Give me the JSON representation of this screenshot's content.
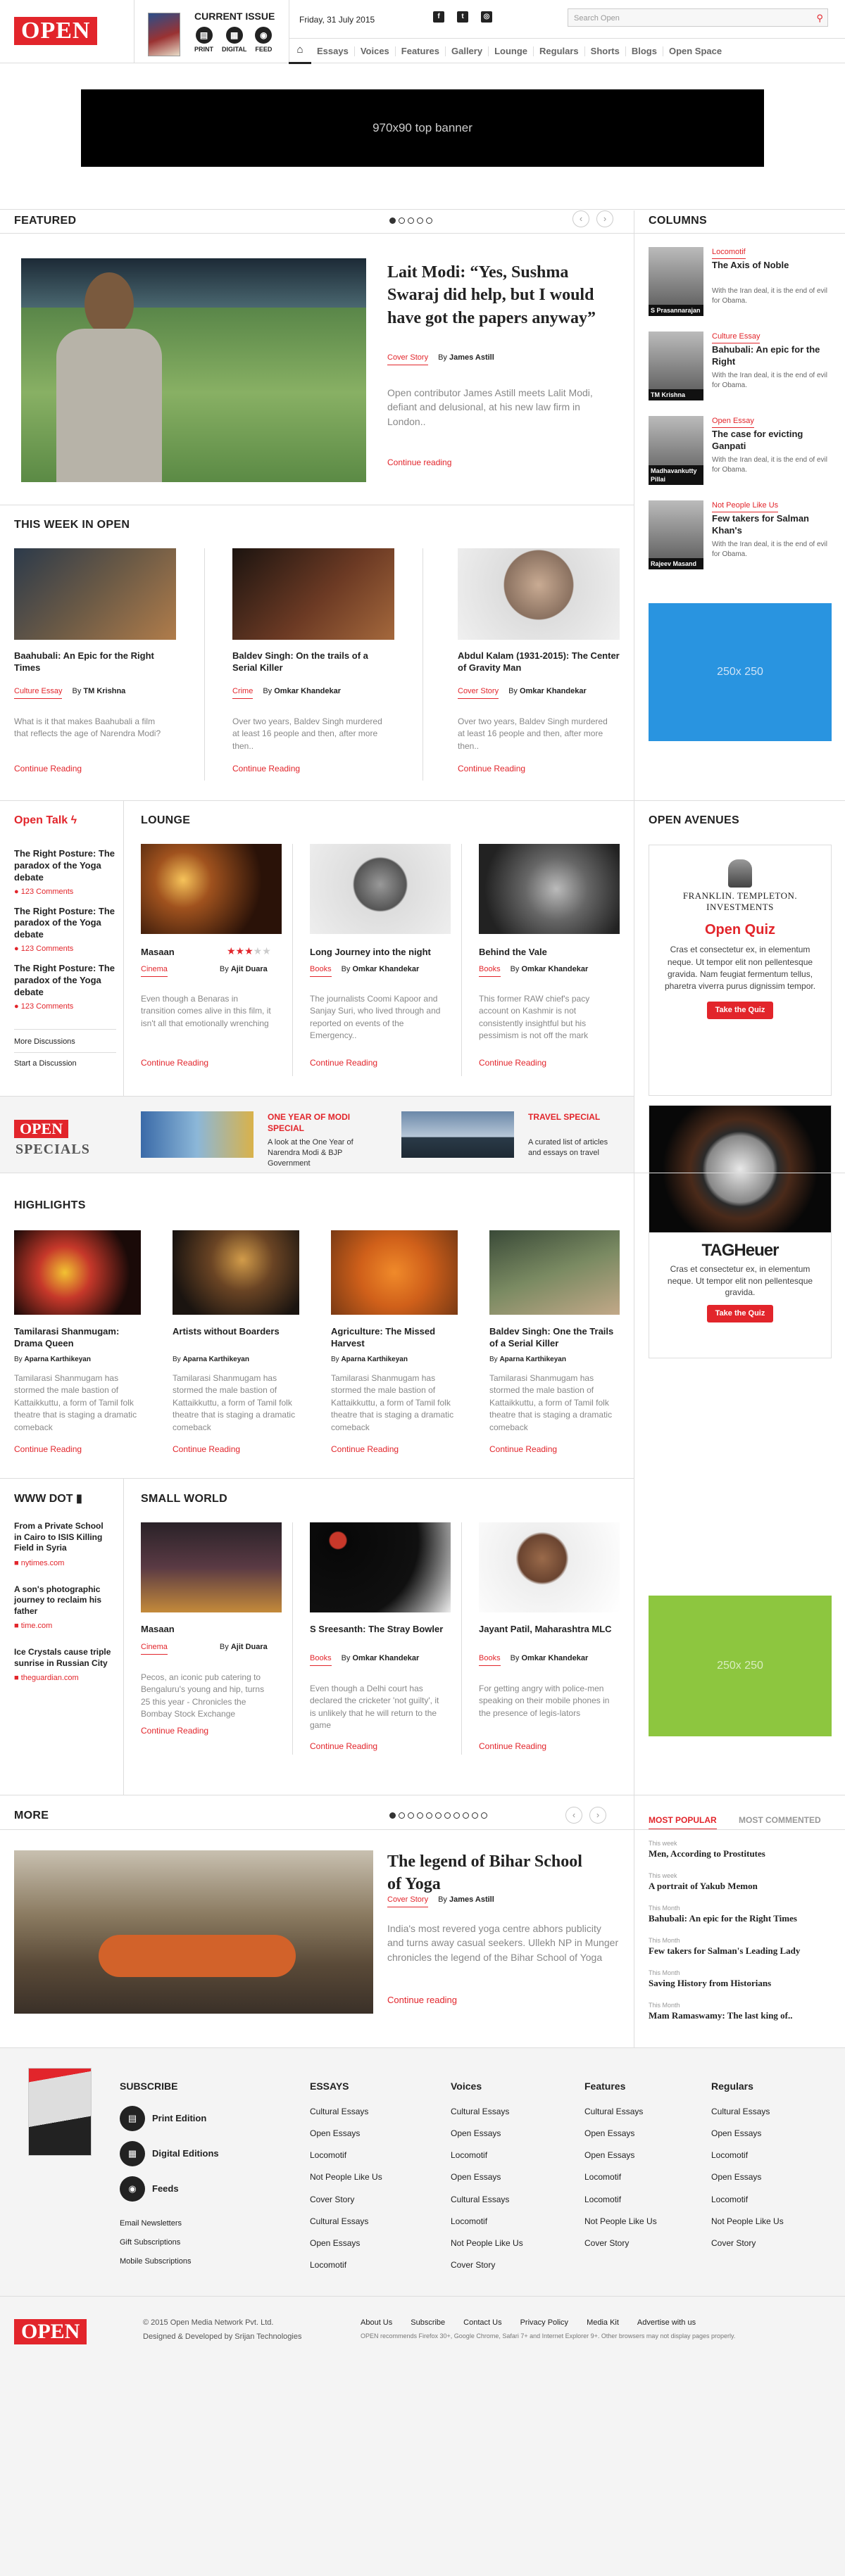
{
  "header": {
    "logo": "OPEN",
    "issue_title": "CURRENT ISSUE",
    "issue_links": [
      {
        "label": "PRINT",
        "glyph": "▤"
      },
      {
        "label": "DIGITAL",
        "glyph": "▦"
      },
      {
        "label": "FEED",
        "glyph": "◉"
      }
    ],
    "date": "Friday, 31 July 2015",
    "social": [
      "f",
      "t",
      "◎"
    ],
    "search_placeholder": "Search Open",
    "nav": [
      "Essays",
      "Voices",
      "Features",
      "Gallery",
      "Lounge",
      "Regulars",
      "Shorts",
      "Blogs",
      "Open Space"
    ]
  },
  "banner": {
    "label": "970x90 top banner"
  },
  "featured": {
    "title": "FEATURED",
    "headline": "Lait Modi: “Yes, Sushma Swaraj did help, but I would have got the papers anyway”",
    "category": "Cover Story",
    "by": "By",
    "author": "James Astill",
    "excerpt": "Open contributor James Astill meets Lalit Modi, defiant and delusional, at his new law firm in London..",
    "continue": "Continue reading"
  },
  "week": {
    "title": "THIS WEEK IN OPEN",
    "items": [
      {
        "headline": "Baahubali: An Epic for the Right Times",
        "category": "Culture Essay",
        "author": "TM Krishna",
        "excerpt": "What is it that makes Baahubali a film that reflects the age of Narendra Modi?",
        "continue": "Continue Reading"
      },
      {
        "headline": "Baldev Singh: On the trails of a Serial Killer",
        "category": "Crime",
        "author": "Omkar Khandekar",
        "excerpt": "Over two years, Baldev Singh murdered at least 16 people and then, after more then..",
        "continue": "Continue Reading"
      },
      {
        "headline": "Abdul Kalam (1931-2015): The Center of Gravity Man",
        "category": "Cover Story",
        "author": "Omkar Khandekar",
        "excerpt": "Over two years, Baldev Singh murdered at least 16 people and then, after more then..",
        "continue": "Continue Reading"
      }
    ]
  },
  "opentalk": {
    "title": "Open Talk",
    "items": [
      {
        "headline": "The Right Posture: The paradox of the Yoga debate",
        "comments": "123 Comments"
      },
      {
        "headline": "The Right Posture: The paradox of the Yoga debate",
        "comments": "123 Comments"
      },
      {
        "headline": "The Right Posture: The paradox of the Yoga debate",
        "comments": "123 Comments"
      }
    ],
    "more": "More Discussions",
    "start": "Start a Discussion"
  },
  "lounge": {
    "title": "LOUNGE",
    "items": [
      {
        "headline": "Masaan",
        "category": "Cinema",
        "author": "Ajit Duara",
        "rating": 3,
        "excerpt": "Even though a Benaras in transition comes alive in this film, it isn't all that emotionally wrenching",
        "continue": "Continue Reading"
      },
      {
        "headline": "Long Journey into the night",
        "category": "Books",
        "author": "Omkar Khandekar",
        "excerpt": "The journalists Coomi Kapoor and Sanjay Suri, who lived through and reported on events of the Emergency..",
        "continue": "Continue Reading"
      },
      {
        "headline": "Behind the Vale",
        "category": "Books",
        "author": "Omkar Khandekar",
        "excerpt": "This former RAW chief's pacy account on Kashmir is not consistently insightful but his pessimism is not off the mark",
        "continue": "Continue Reading"
      }
    ]
  },
  "specials": {
    "logo_top": "OPEN",
    "logo_bottom": "SPECIALS",
    "items": [
      {
        "title": "ONE YEAR OF MODI SPECIAL",
        "text": "A look at the One Year of Narendra Modi & BJP Government"
      },
      {
        "title": "TRAVEL SPECIAL",
        "text": "A curated list of articles and essays on travel"
      }
    ]
  },
  "highlights": {
    "title": "HIGHLIGHTS",
    "items": [
      {
        "headline": "Tamilarasi Shanmugam: Drama Queen",
        "author": "Aparna Karthikeyan",
        "excerpt": "Tamilarasi Shanmugam has stormed the male bastion of Kattaikkuttu, a form of Tamil folk theatre that is staging a dramatic comeback",
        "continue": "Continue Reading"
      },
      {
        "headline": "Artists without Boarders",
        "author": "Aparna Karthikeyan",
        "excerpt": "Tamilarasi Shanmugam has stormed the male bastion of Kattaikkuttu, a form of Tamil folk theatre that is staging a dramatic comeback",
        "continue": "Continue Reading"
      },
      {
        "headline": "Agriculture: The Missed Harvest",
        "author": "Aparna Karthikeyan",
        "excerpt": "Tamilarasi Shanmugam has stormed the male bastion of Kattaikkuttu, a form of Tamil folk theatre that is staging a dramatic comeback",
        "continue": "Continue Reading"
      },
      {
        "headline": "Baldev Singh: One the Trails of a Serial Killer",
        "author": "Aparna Karthikeyan",
        "excerpt": "Tamilarasi Shanmugam has stormed the male bastion of Kattaikkuttu, a form of Tamil folk theatre that is staging a dramatic comeback",
        "continue": "Continue Reading"
      }
    ]
  },
  "wwwdot": {
    "title": "WWW DOT",
    "items": [
      {
        "headline": "From a Private School in Cairo to ISIS Killing Field in Syria",
        "source": "nytimes.com"
      },
      {
        "headline": "A son's photographic journey to reclaim his father",
        "source": "time.com"
      },
      {
        "headline": "Ice Crystals cause triple sunrise in Russian City",
        "source": "theguardian.com"
      }
    ]
  },
  "smallworld": {
    "title": "SMALL WORLD",
    "items": [
      {
        "headline": "Masaan",
        "category": "Cinema",
        "author": "Ajit Duara",
        "excerpt": "Pecos, an iconic pub catering to Bengaluru's young and hip, turns 25 this year - Chronicles the Bombay Stock Exchange",
        "continue": "Continue Reading"
      },
      {
        "headline": "S Sreesanth: The Stray Bowler",
        "category": "Books",
        "author": "Omkar Khandekar",
        "excerpt": "Even though a Delhi court has declared the cricketer 'not guilty', it is unlikely that he will return to the game",
        "continue": "Continue Reading"
      },
      {
        "headline": "Jayant Patil, Maharashtra MLC",
        "category": "Books",
        "author": "Omkar Khandekar",
        "excerpt": "For getting angry with police-men speaking on their mobile phones in the presence of legis-lators",
        "continue": "Continue Reading"
      }
    ]
  },
  "more": {
    "title": "MORE",
    "headline": "The legend of Bihar School of Yoga",
    "category": "Cover Story",
    "author": "James Astill",
    "excerpt": "India's most revered yoga centre abhors publicity and turns away casual seekers. Ullekh NP in Munger chronicles the legend of the Bihar School of Yoga",
    "continue": "Continue reading"
  },
  "columns": {
    "title": "COLUMNS",
    "items": [
      {
        "tag": "Locomotif",
        "headline": "The Axis of Noble",
        "text": "With the Iran deal, it is the end of evil for Obama.",
        "name": "S Prasannarajan"
      },
      {
        "tag": "Culture Essay",
        "headline": "Bahubali: An epic for the Right",
        "text": "With the Iran deal, it is the end of evil for Obama.",
        "name": "TM Krishna"
      },
      {
        "tag": "Open Essay",
        "headline": "The case for evicting Ganpati",
        "text": "With the Iran deal, it is the end of evil for Obama.",
        "name": "Madhavankutty Pillai"
      },
      {
        "tag": "Not People Like Us",
        "headline": "Few takers for Salman Khan's",
        "text": "With the Iran deal, it is the end of evil for Obama.",
        "name": "Rajeev Masand"
      }
    ]
  },
  "ads": {
    "box1": "250x 250",
    "box2": "250x 250"
  },
  "avenues": {
    "title": "OPEN AVENUES",
    "franklin": "FRANKLIN. TEMPLETON. INVESTMENTS",
    "quiz_title": "Open Quiz",
    "quiz_text": "Cras et consectetur ex, in elementum neque. Ut tempor elit non pellentesque gravida. Nam feugiat fermentum tellus, pharetra viverra purus dignissim tempor.",
    "quiz_btn": "Take the Quiz",
    "tag_brand": "TAGHeuer",
    "tag_text": "Cras et consectetur ex, in elementum neque. Ut tempor elit non pellentesque gravida.",
    "tag_btn": "Take the Quiz"
  },
  "popular": {
    "tab_active": "MOST POPULAR",
    "tab_other": "MOST COMMENTED",
    "items": [
      {
        "label": "This week",
        "title": "Men, According to Prostitutes"
      },
      {
        "label": "This week",
        "title": "A portrait of Yakub Memon"
      },
      {
        "label": "This Month",
        "title": "Bahubali: An epic for the Right Times"
      },
      {
        "label": "This Month",
        "title": "Few takers for Salman's Leading Lady"
      },
      {
        "label": "This Month",
        "title": "Saving History from Historians"
      },
      {
        "label": "This Month",
        "title": "Mam Ramaswamy: The last king of.."
      }
    ]
  },
  "footer": {
    "subscribe": "SUBSCRIBE",
    "sub_links": [
      {
        "label": "Print Edition",
        "glyph": "▤"
      },
      {
        "label": "Digital Editions",
        "glyph": "▦"
      },
      {
        "label": "Feeds",
        "glyph": "◉"
      }
    ],
    "sub_small": [
      "Email Newsletters",
      "Gift Subscriptions",
      "Mobile Subscriptions"
    ],
    "cols": [
      {
        "title": "ESSAYS",
        "links": [
          "Cultural Essays",
          "Open Essays",
          "Locomotif",
          "Not People Like Us",
          "Cover Story",
          "Cultural Essays",
          "Open Essays",
          "Locomotif"
        ]
      },
      {
        "title": "Voices",
        "links": [
          "Cultural Essays",
          "Open Essays",
          "Locomotif",
          "Open Essays",
          "Cultural Essays",
          "Locomotif",
          "Not People Like Us",
          "Cover Story"
        ]
      },
      {
        "title": "Features",
        "links": [
          "Cultural Essays",
          "Open Essays",
          "Open Essays",
          "Locomotif",
          "Locomotif",
          "Not People Like Us",
          "Cover Story"
        ]
      },
      {
        "title": "Regulars",
        "links": [
          "Cultural Essays",
          "Open Essays",
          "Locomotif",
          "Open Essays",
          "Locomotif",
          "Not People Like Us",
          "Cover Story"
        ]
      }
    ],
    "logo": "OPEN",
    "copyright": "© 2015 Open Media Network Pvt. Ltd.",
    "designed": "Designed & Developed by Srijan Technologies",
    "links": [
      "About Us",
      "Subscribe",
      "Contact Us",
      "Privacy Policy",
      "Media Kit",
      "Advertise with us"
    ],
    "browser_note": "OPEN recommends Firefox 30+, Google Chrome, Safari 7+ and Internet Explorer 9+. Other browsers may not display pages properly."
  }
}
